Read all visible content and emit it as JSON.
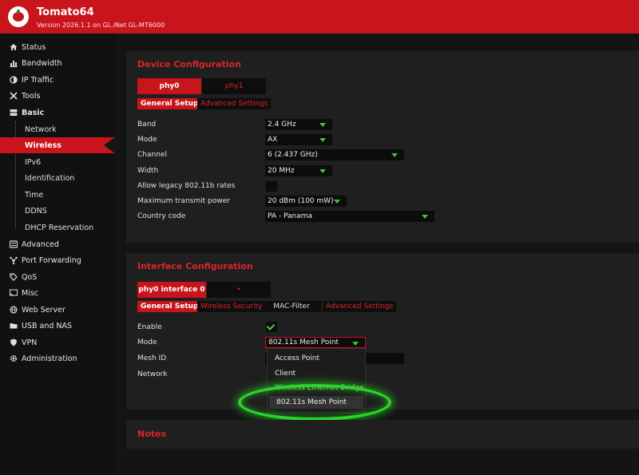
{
  "app": {
    "title": "Tomato64",
    "version": "Version 2026.1.1 on GL.iNet GL-MT6000"
  },
  "sidebar": {
    "items": [
      {
        "label": "Status",
        "icon": "home-icon"
      },
      {
        "label": "Bandwidth",
        "icon": "bar-chart-icon"
      },
      {
        "label": "IP Traffic",
        "icon": "half-circle-icon"
      },
      {
        "label": "Tools",
        "icon": "wrench-icon"
      },
      {
        "label": "Basic",
        "icon": "server-icon"
      },
      {
        "label": "Advanced",
        "icon": "sliders-icon"
      },
      {
        "label": "Port Forwarding",
        "icon": "network-icon"
      },
      {
        "label": "QoS",
        "icon": "tag-icon"
      },
      {
        "label": "Misc",
        "icon": "cast-icon"
      },
      {
        "label": "Web Server",
        "icon": "globe-icon"
      },
      {
        "label": "USB and NAS",
        "icon": "folder-icon"
      },
      {
        "label": "VPN",
        "icon": "shield-icon"
      },
      {
        "label": "Administration",
        "icon": "gear-icon"
      }
    ],
    "basic_subitems": [
      "Network",
      "Wireless",
      "IPv6",
      "Identification",
      "Time",
      "DDNS",
      "DHCP Reservation"
    ],
    "active_subitem": "Wireless"
  },
  "device_config": {
    "title": "Device Configuration",
    "tabs": [
      "phy0",
      "phy1"
    ],
    "subtabs": [
      "General Setup",
      "Advanced Settings"
    ],
    "fields": [
      {
        "label": "Band",
        "value": "2.4 GHz"
      },
      {
        "label": "Mode",
        "value": "AX"
      },
      {
        "label": "Channel",
        "value": "6 (2.437 GHz)"
      },
      {
        "label": "Width",
        "value": "20 MHz"
      },
      {
        "label": "Allow legacy 802.11b rates",
        "value": ""
      },
      {
        "label": "Maximum transmit power",
        "value": "20 dBm (100 mW)"
      },
      {
        "label": "Country code",
        "value": "PA - Panama"
      }
    ]
  },
  "interface_config": {
    "title": "Interface Configuration",
    "tabs": [
      "phy0 interface 0",
      "•"
    ],
    "subtabs": [
      "General Setup",
      "Wireless Security",
      "MAC-Filter",
      "Advanced Settings"
    ],
    "fields": [
      {
        "label": "Enable",
        "checked": true
      },
      {
        "label": "Mode",
        "value": "802.11s Mesh Point"
      },
      {
        "label": "Mesh ID",
        "value": ""
      },
      {
        "label": "Network",
        "value": ""
      }
    ],
    "mode_options": [
      "Access Point",
      "Client",
      "Wireless Ethernet Bridge",
      "802.11s Mesh Point"
    ],
    "mode_selected": "802.11s Mesh Point"
  },
  "notes": {
    "title": "Notes"
  },
  "colors": {
    "accent": "#c8141b",
    "highlight": "#2ad42a",
    "caret": "#3cc43c"
  }
}
